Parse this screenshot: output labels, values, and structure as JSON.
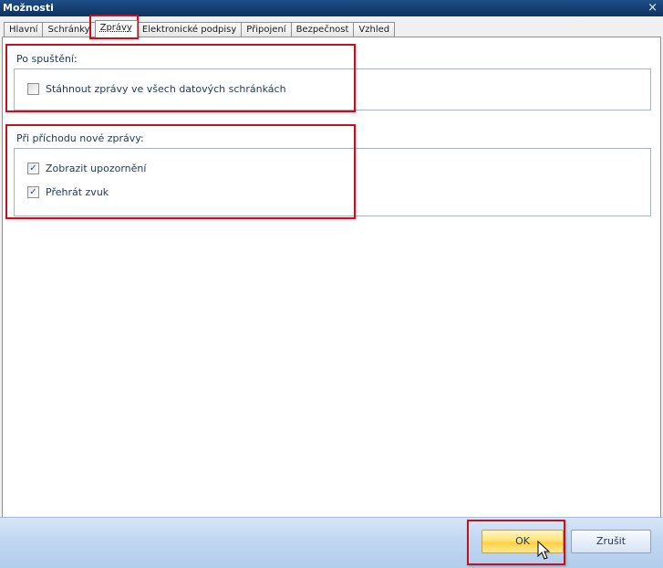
{
  "window": {
    "title": "Možnosti",
    "close_glyph": "×"
  },
  "tabs": [
    {
      "label": "Hlavní",
      "active": false
    },
    {
      "label": "Schránky",
      "active": false
    },
    {
      "label": "Zprávy",
      "active": true
    },
    {
      "label": "Elektronické podpisy",
      "active": false
    },
    {
      "label": "Připojení",
      "active": false
    },
    {
      "label": "Bezpečnost",
      "active": false
    },
    {
      "label": "Vzhled",
      "active": false
    }
  ],
  "startup_group": {
    "title": "Po spuštění:",
    "options": [
      {
        "label": "Stáhnout zprávy ve všech datových schránkách",
        "checked": false
      }
    ]
  },
  "new_message_group": {
    "title": "Při příchodu nové zprávy:",
    "options": [
      {
        "label": "Zobrazit upozornění",
        "checked": true
      },
      {
        "label": "Přehrát zvuk",
        "checked": true
      }
    ]
  },
  "buttons": {
    "ok": "OK",
    "cancel": "Zrušit"
  },
  "colors": {
    "highlight": "#c2121f",
    "titlebar": "#163f74",
    "group_text": "#1e395b"
  }
}
